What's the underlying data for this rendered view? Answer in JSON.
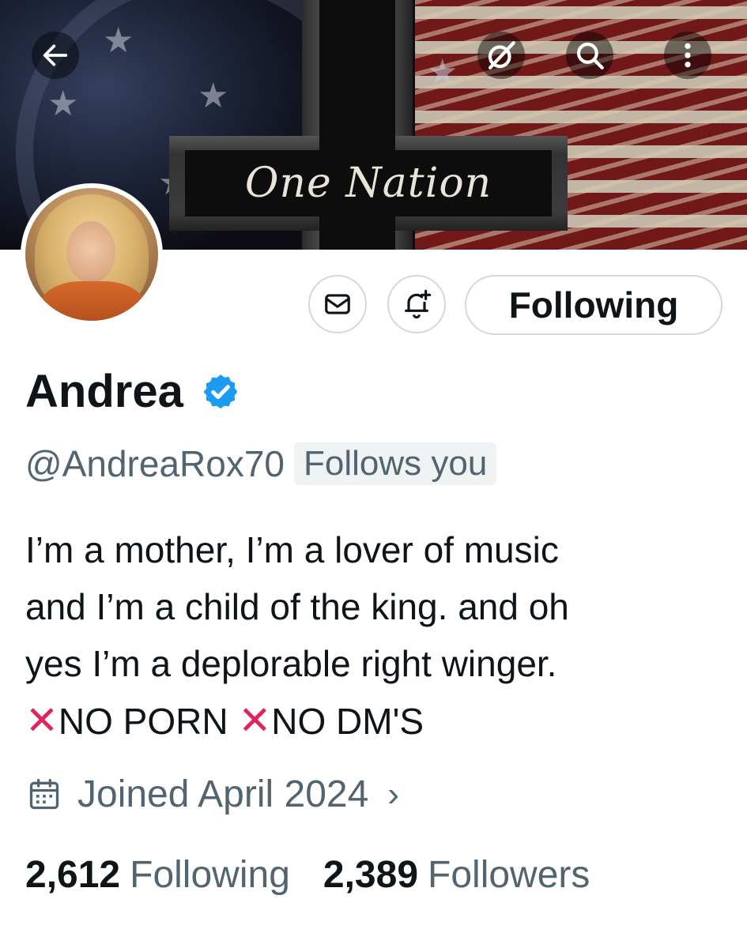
{
  "banner": {
    "text": "One Nation",
    "icons": {
      "back": "arrow-left-icon",
      "grok": "slashed-circle-icon",
      "search": "search-icon",
      "more": "more-vertical-icon"
    }
  },
  "actions": {
    "message_icon": "envelope-icon",
    "notify_icon": "bell-plus-icon",
    "follow_label": "Following"
  },
  "profile": {
    "name": "Andrea",
    "verified": true,
    "handle": "@AndreaRox70",
    "follows_you": "Follows you",
    "bio_lines": [
      "I’m a mother, I’m a lover of music",
      "and I’m a child of the king. and oh",
      "yes I’m a deplorable right winger."
    ],
    "bio_flags": [
      "NO PORN",
      "NO DM'S"
    ],
    "joined": "Joined April 2024",
    "following_count": "2,612",
    "following_label": "Following",
    "followers_count": "2,389",
    "followers_label": "Followers"
  },
  "colors": {
    "text": "#0f1419",
    "secondary": "#536471",
    "verified": "#1d9bf0",
    "border": "#cfd9de"
  }
}
